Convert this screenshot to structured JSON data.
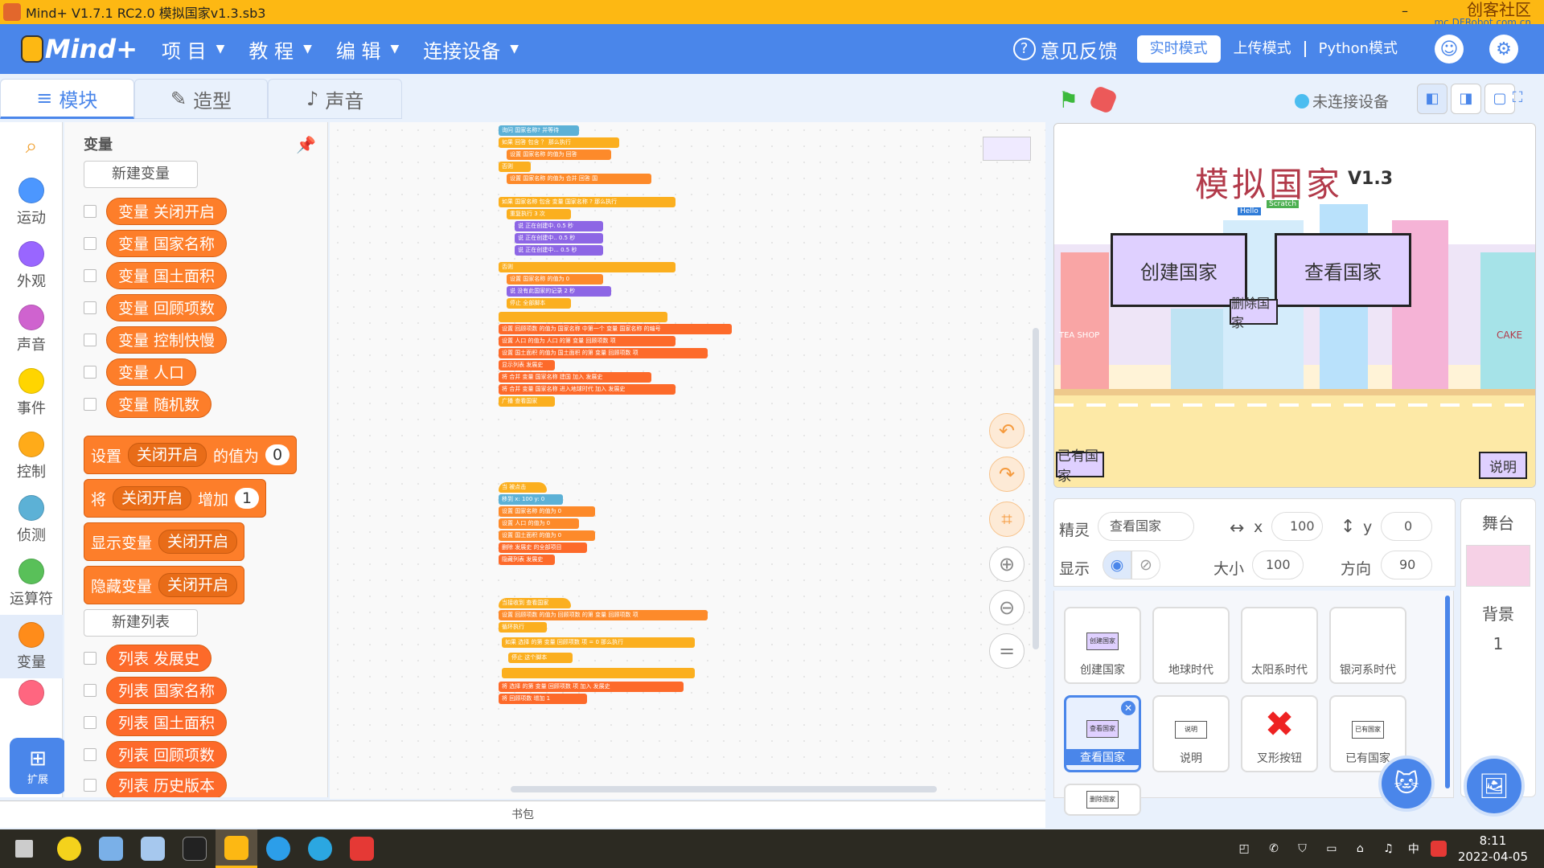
{
  "window": {
    "title": "Mind+ V1.7.1 RC2.0   模拟国家v1.3.sb3",
    "watermark_main": "创客社区",
    "watermark_sub": "mc.DFRobot.com.cn"
  },
  "menubar": {
    "logo": "Mind+",
    "menus": [
      "项 目",
      "教 程",
      "编 辑",
      "连接设备"
    ],
    "feedback": "意见反馈",
    "modes": [
      "实时模式",
      "上传模式",
      "Python模式"
    ],
    "active_mode": "实时模式"
  },
  "tabs": [
    "模块",
    "造型",
    "声音"
  ],
  "categories": [
    {
      "label": "运动",
      "color": "#4c97ff"
    },
    {
      "label": "外观",
      "color": "#9966ff"
    },
    {
      "label": "声音",
      "color": "#cf63cf"
    },
    {
      "label": "事件",
      "color": "#ffd500"
    },
    {
      "label": "控制",
      "color": "#ffab19"
    },
    {
      "label": "侦测",
      "color": "#5cb1d6"
    },
    {
      "label": "运算符",
      "color": "#59c059"
    },
    {
      "label": "变量",
      "color": "#ff8c1a"
    }
  ],
  "extension": "扩展",
  "palette": {
    "heading": "变量",
    "new_variable": "新建变量",
    "variables": [
      "变量 关闭开启",
      "变量 国家名称",
      "变量 国土面积",
      "变量 回顾项数",
      "变量 控制快慢",
      "变量 人口",
      "变量 随机数"
    ],
    "set_block": {
      "a": "设置",
      "dd": "关闭开启",
      "b": "的值为",
      "v": "0"
    },
    "change_block": {
      "a": "将",
      "dd": "关闭开启",
      "b": "增加",
      "v": "1"
    },
    "show_block": {
      "a": "显示变量",
      "dd": "关闭开启"
    },
    "hide_block": {
      "a": "隐藏变量",
      "dd": "关闭开启"
    },
    "new_list": "新建列表",
    "lists": [
      "列表 发展史",
      "列表 国家名称",
      "列表 国土面积",
      "列表 回顾项数",
      "列表 历史版本"
    ]
  },
  "backpack": "书包",
  "stage_header": {
    "device_status": "未连接设备"
  },
  "stage": {
    "title": "模拟国家",
    "version": "V1.3",
    "btn_create": "创建国家",
    "btn_view": "查看国家",
    "btn_delete": "删除国家",
    "btn_existing": "已有国家",
    "btn_help": "说明",
    "shop1": "TEA SHOP",
    "shop2": "CAKE",
    "sign": "Scratch",
    "sign2": "Hello"
  },
  "sprite_info": {
    "sprite_label": "精灵",
    "sprite_name": "查看国家",
    "x_label": "x",
    "x": "100",
    "y_label": "y",
    "y": "0",
    "show_label": "显示",
    "size_label": "大小",
    "size": "100",
    "dir_label": "方向",
    "dir": "90"
  },
  "sprites": [
    {
      "name": "创建国家",
      "thumb": "创建国家"
    },
    {
      "name": "地球时代",
      "thumb": ""
    },
    {
      "name": "太阳系时代",
      "thumb": ""
    },
    {
      "name": "银河系时代",
      "thumb": ""
    },
    {
      "name": "查看国家",
      "thumb": "查看国家"
    },
    {
      "name": "说明",
      "thumb": "说明"
    },
    {
      "name": "叉形按钮",
      "thumb": ""
    },
    {
      "name": "已有国家",
      "thumb": "已有国家"
    },
    {
      "name": "",
      "thumb": "删除国家"
    }
  ],
  "stage_panel": {
    "label": "舞台",
    "bg_label": "背景",
    "bg_count": "1"
  },
  "scripts": {
    "s1": [
      "询问 国家名称? 并等待",
      "如果 回答 包含 ？ 那么执行",
      "设置 国家名称 的值为 回答",
      "否则",
      "设置 国家名称 的值为 合并 回答 国",
      "如果 国家名称 包含 变量 国家名称 ? 那么执行",
      "重复执行 3 次",
      "说 正在创建中. 0.5 秒",
      "说 正在创建中.. 0.5 秒",
      "说 正在创建中... 0.5 秒",
      "否则",
      "设置 国家名称 的值为 0",
      "说 没有此国家的记录 2 秒",
      "停止 全部脚本"
    ],
    "s1b": [
      "设置 回顾项数 的值为 国家名称 中第一个 变量 国家名称 的编号",
      "设置 人口 的值为 人口 的第 变量 回顾项数 项",
      "设置 国土面积 的值为 国土面积 的第 变量 回顾项数 项",
      "显示列表 发展史",
      "将 合并 变量 国家名称 建国 加入 发展史",
      "将 合并 变量 国家名称 进入地球时代 加入 发展史",
      "广播 查看国家"
    ],
    "s2": [
      "当 被点击",
      "移到 x: 100 y: 0",
      "设置 国家名称 的值为 0",
      "设置 人口 的值为 0",
      "设置 国土面积 的值为 0",
      "删除 发展史 的全部项目",
      "隐藏列表 发展史"
    ],
    "s3": [
      "当接收到 查看国家",
      "设置 回顾项数 的值为 回顾项数 的第 变量 回顾项数 项",
      "循环执行",
      "如果 选择 的第 变量 回顾项数 项 = 0 那么执行",
      "停止 这个脚本",
      "将 选择 的第 变量 回顾项数 项 加入 发展史",
      "将 回顾项数 增加 1"
    ]
  },
  "taskbar": {
    "time": "8:11",
    "date": "2022-04-05",
    "ime": "中"
  }
}
